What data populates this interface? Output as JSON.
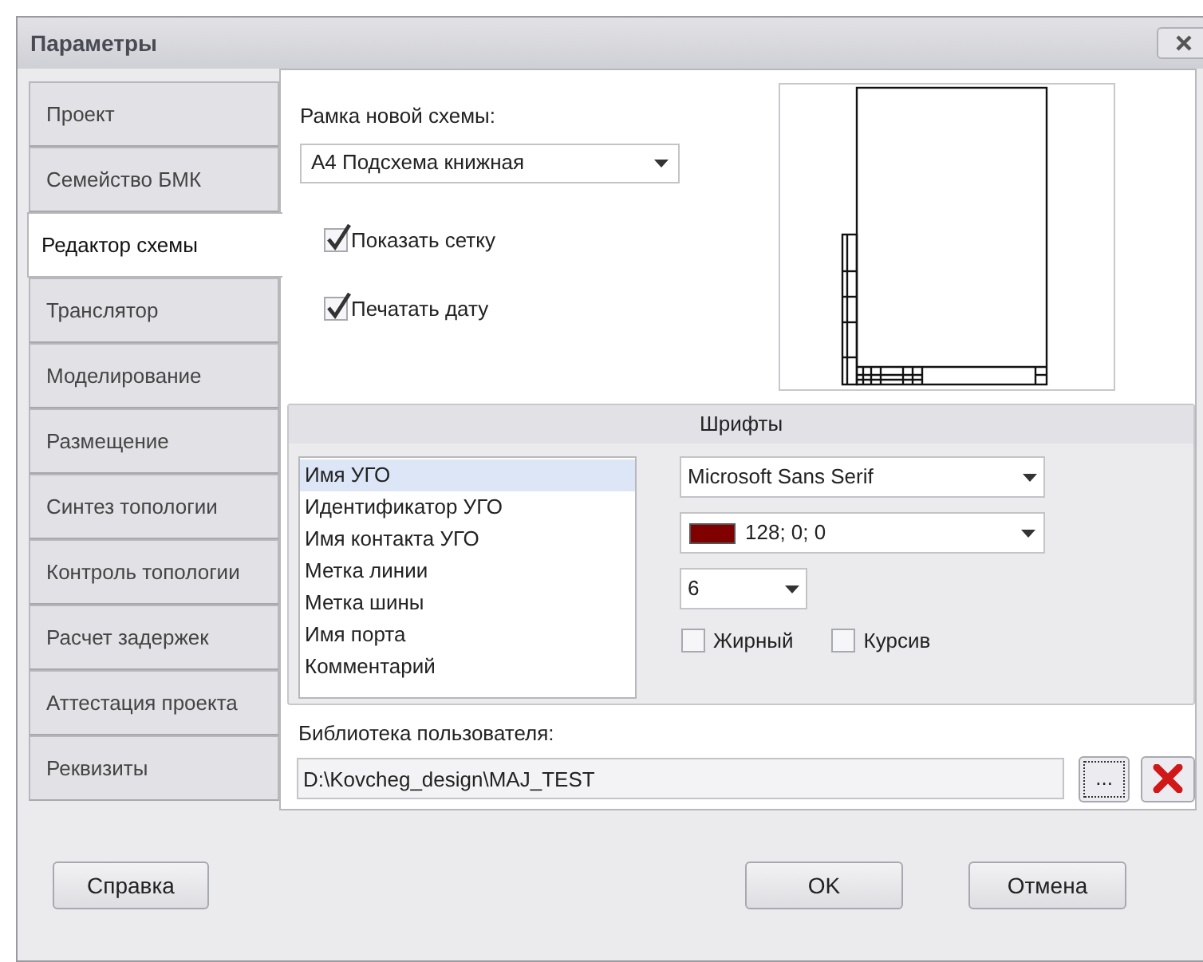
{
  "window": {
    "title": "Параметры"
  },
  "tabs": [
    {
      "label": "Проект",
      "selected": false
    },
    {
      "label": "Семейство БМК",
      "selected": false
    },
    {
      "label": "Редактор схемы",
      "selected": true
    },
    {
      "label": "Транслятор",
      "selected": false
    },
    {
      "label": "Моделирование",
      "selected": false
    },
    {
      "label": "Размещение",
      "selected": false
    },
    {
      "label": "Синтез топологии",
      "selected": false
    },
    {
      "label": "Контроль топологии",
      "selected": false
    },
    {
      "label": "Расчет задержек",
      "selected": false
    },
    {
      "label": "Аттестация проекта",
      "selected": false
    },
    {
      "label": "Реквизиты",
      "selected": false
    }
  ],
  "frame": {
    "label": "Рамка новой схемы:",
    "value": "А4 Подсхема книжная"
  },
  "options": [
    {
      "label": "Показать сетку",
      "checked": true
    },
    {
      "label": "Печатать дату",
      "checked": true
    }
  ],
  "fonts": {
    "title": "Шрифты",
    "items": [
      {
        "label": "Имя УГО",
        "selected": true
      },
      {
        "label": "Идентификатор УГО",
        "selected": false
      },
      {
        "label": "Имя контакта УГО",
        "selected": false
      },
      {
        "label": "Метка линии",
        "selected": false
      },
      {
        "label": "Метка шины",
        "selected": false
      },
      {
        "label": "Имя порта",
        "selected": false
      },
      {
        "label": "Комментарий",
        "selected": false
      }
    ],
    "font_family": "Microsoft Sans Serif",
    "color": {
      "value": "128; 0; 0",
      "color": "#800000"
    },
    "size": "6",
    "styles": [
      {
        "label": "Жирный",
        "checked": false
      },
      {
        "label": "Курсив",
        "checked": false
      }
    ]
  },
  "library": {
    "label": "Библиотека пользователя:",
    "value": "D:\\Kovcheg_design\\MAJ_TEST",
    "browse": "..."
  },
  "buttons": {
    "help": "Справка",
    "ok": "OK",
    "cancel": "Отмена"
  }
}
